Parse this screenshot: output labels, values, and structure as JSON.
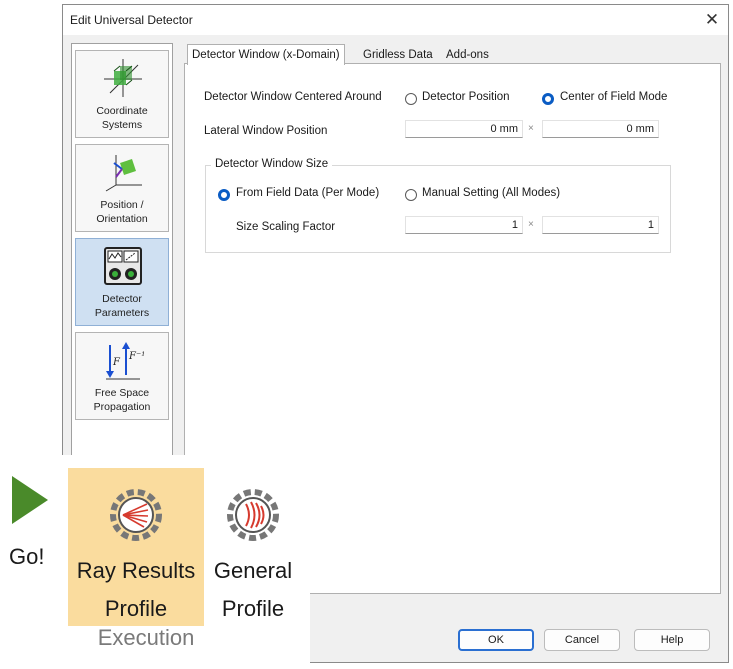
{
  "window": {
    "title": "Edit Universal Detector",
    "close": "✕"
  },
  "sidebar": {
    "items": [
      {
        "label1": "Coordinate",
        "label2": "Systems",
        "icon": "coordinate-systems-icon"
      },
      {
        "label1": "Position /",
        "label2": "Orientation",
        "icon": "position-orientation-icon"
      },
      {
        "label1": "Detector",
        "label2": "Parameters",
        "icon": "detector-parameters-icon",
        "active": true
      },
      {
        "label1": "Free Space",
        "label2": "Propagation",
        "icon": "free-space-propagation-icon"
      }
    ]
  },
  "tabs": [
    {
      "label": "Detector Window (x-Domain)",
      "active": true
    },
    {
      "label": "Gridless Data"
    },
    {
      "label": "Add-ons"
    }
  ],
  "form": {
    "centered_label": "Detector Window Centered Around",
    "opt_detector_position": "Detector Position",
    "opt_center_field": "Center of Field Mode",
    "lateral_label": "Lateral Window Position",
    "lateral_x": "0 mm",
    "lateral_y": "0 mm",
    "times": "×",
    "size_group_title": "Detector Window Size",
    "opt_from_field": "From Field Data (Per Mode)",
    "opt_manual": "Manual Setting (All Modes)",
    "scaling_label": "Size Scaling Factor",
    "scaling_x": "1",
    "scaling_y": "1"
  },
  "buttons": {
    "ok": "OK",
    "cancel": "Cancel",
    "help": "Help"
  },
  "ribbon": {
    "go": "Go!",
    "ray_results_1": "Ray Results",
    "ray_results_2": "Profile",
    "general_1": "General",
    "general_2": "Profile",
    "group": "Execution"
  },
  "colors": {
    "accent": "#0a5cc4",
    "active_sidebar": "#cfe0f2",
    "ray_tile": "#fadc9e",
    "go_green": "#4a8a2a",
    "ray_red": "#d63a2e"
  }
}
